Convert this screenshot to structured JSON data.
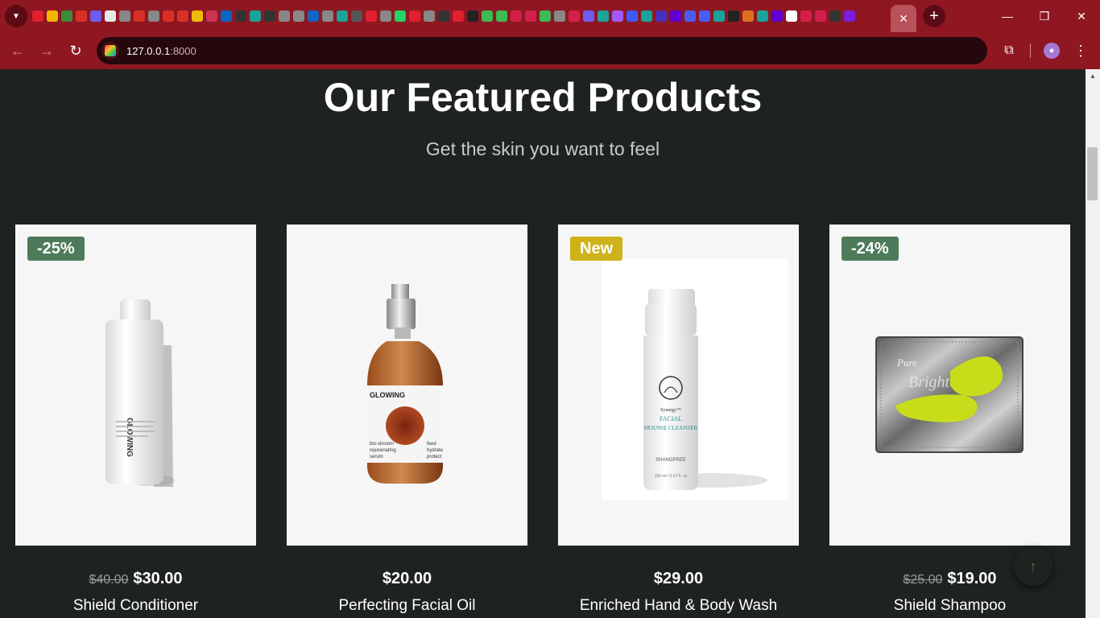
{
  "browser": {
    "url_host": "127.0.0.1",
    "url_port": ":8000",
    "pinned_tab_colors": [
      "#e0202e",
      "#f4b400",
      "#3c8b3c",
      "#d93025",
      "#6e5cf0",
      "#e8e8e8",
      "#888888",
      "#d93025",
      "#888888",
      "#d93025",
      "#d93025",
      "#f0b90b",
      "#cc3355",
      "#0a66c2",
      "#333333",
      "#1aa39a",
      "#333333",
      "#888888",
      "#888888",
      "#1565c0",
      "#888888",
      "#1aa39a",
      "#555555",
      "#e0202e",
      "#888888",
      "#25d366",
      "#e0202e",
      "#888888",
      "#333333",
      "#e0202e",
      "#222222",
      "#3cba54",
      "#3cba54",
      "#d3204a",
      "#d3204a",
      "#3cba54",
      "#888888",
      "#d3204a",
      "#6e5cf0",
      "#1aa39a",
      "#a259ff",
      "#3d5afe",
      "#1aa39a",
      "#4a2fbd",
      "#6001d2",
      "#4a5df0",
      "#4a5df0",
      "#1aa39a",
      "#222222",
      "#e07020",
      "#1aa39a",
      "#6001d2",
      "#ffffff",
      "#d3204a",
      "#d3204a",
      "#333333",
      "#7a1ee0"
    ],
    "active_tab_icon": "close-icon",
    "window_controls": [
      "minimize-icon",
      "restore-icon",
      "close-icon"
    ]
  },
  "page": {
    "title": "Our Featured Products",
    "subtitle": "Get the skin you want to feel"
  },
  "products": [
    {
      "name": "Shield Conditioner",
      "badge": "-25%",
      "badge_type": "sale",
      "old_price": "$40.00",
      "price": "$30.00"
    },
    {
      "name": "Perfecting Facial Oil",
      "badge": "",
      "badge_type": "",
      "old_price": "",
      "price": "$20.00"
    },
    {
      "name": "Enriched Hand & Body Wash",
      "badge": "New",
      "badge_type": "new",
      "old_price": "",
      "price": "$29.00"
    },
    {
      "name": "Shield Shampoo",
      "badge": "-24%",
      "badge_type": "sale",
      "old_price": "$25.00",
      "price": "$19.00"
    }
  ],
  "product_label_texts": {
    "bottle_brand": "GLOWING",
    "serum_brand": "GLOWING",
    "serum_line1": "bio-shroom",
    "serum_line2": "rejuvenating",
    "serum_line3": "serum",
    "serum_side1": "feed",
    "serum_side2": "hydrate",
    "serum_side3": "protect",
    "cleanser_brand": "Synergy™",
    "cleanser_line1": "FACIAL",
    "cleanser_line2": "MOUSSE CLEANSER",
    "cleanser_maker": "SHANGPREE",
    "cleanser_size": "150 ml / 5.07 fl. oz",
    "patch_text": "Bright Eyes",
    "patch_pure": "Pure"
  },
  "colors": {
    "page_bg": "#1f231f",
    "sale_badge": "#4d7b5a",
    "new_badge": "#cfb21a",
    "browser_frame": "#8e1722"
  }
}
